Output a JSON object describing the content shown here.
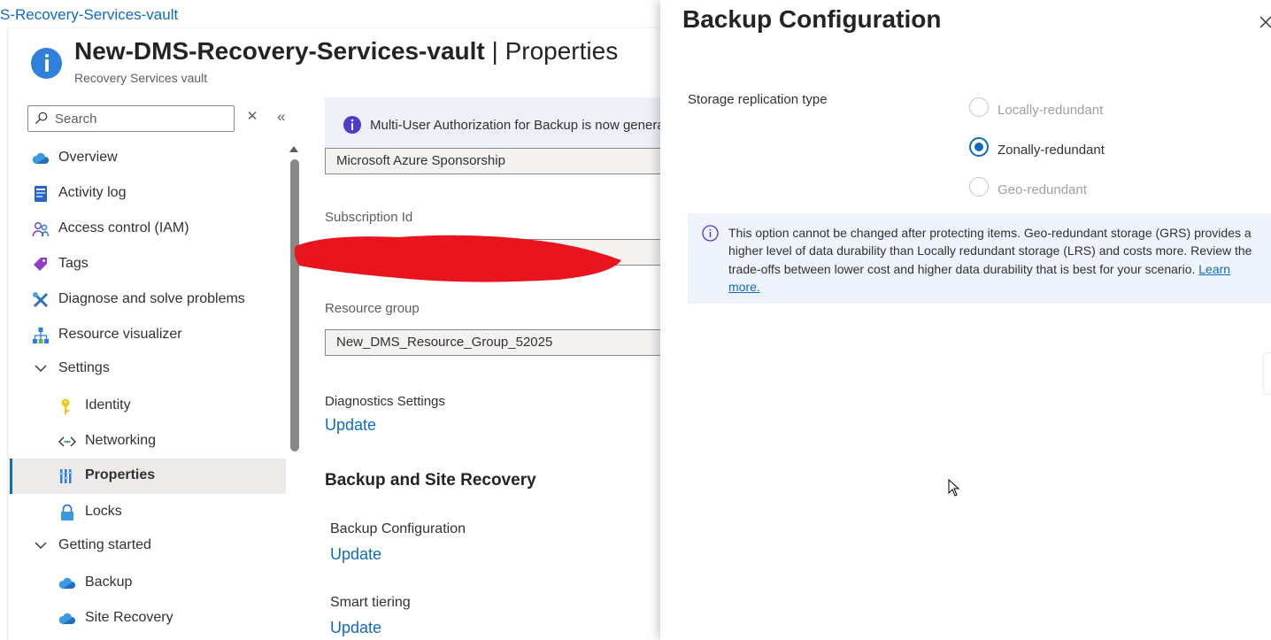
{
  "breadcrumb": "S-Recovery-Services-vault",
  "header": {
    "title_bold": "New-DMS-Recovery-Services-vault",
    "title_sep": " | ",
    "title_page": "Properties",
    "subtitle": "Recovery Services vault"
  },
  "search": {
    "placeholder": "Search"
  },
  "nav": {
    "overview": "Overview",
    "activity_log": "Activity log",
    "access_control": "Access control (IAM)",
    "tags": "Tags",
    "diagnose": "Diagnose and solve problems",
    "resource_visualizer": "Resource visualizer",
    "settings": "Settings",
    "identity": "Identity",
    "networking": "Networking",
    "properties": "Properties",
    "locks": "Locks",
    "getting_started": "Getting started",
    "backup": "Backup",
    "site_recovery": "Site Recovery"
  },
  "main": {
    "banner": "Multi-User Authorization for Backup is now generally available",
    "subscription_value": "Microsoft Azure Sponsorship",
    "subscription_id_label": "Subscription Id",
    "resource_group_label": "Resource group",
    "resource_group_value": "New_DMS_Resource_Group_52025",
    "diagnostics_label": "Diagnostics Settings",
    "diagnostics_link": "Update",
    "section_title": "Backup and Site Recovery",
    "backup_config_label": "Backup Configuration",
    "backup_config_link": "Update",
    "smart_tiering_label": "Smart tiering",
    "smart_tiering_link": "Update"
  },
  "panel": {
    "title": "Backup Configuration",
    "storage_label": "Storage replication type",
    "options": [
      {
        "label": "Locally-redundant",
        "selected": false,
        "disabled": true
      },
      {
        "label": "Zonally-redundant",
        "selected": true,
        "disabled": false
      },
      {
        "label": "Geo-redundant",
        "selected": false,
        "disabled": true
      }
    ],
    "info_text": "This option cannot be changed after protecting items. Geo-redundant storage (GRS) provides a higher level of data durability than Locally redundant storage (LRS) and costs more. Review the trade-offs between lower cost and higher data durability that is best for your scenario.",
    "learn_more": "Learn more."
  },
  "colors": {
    "accent": "#0f6cbd",
    "redaction": "#e8141e",
    "banner_bg": "#eef0f8",
    "info_bg": "#eff3fb"
  }
}
